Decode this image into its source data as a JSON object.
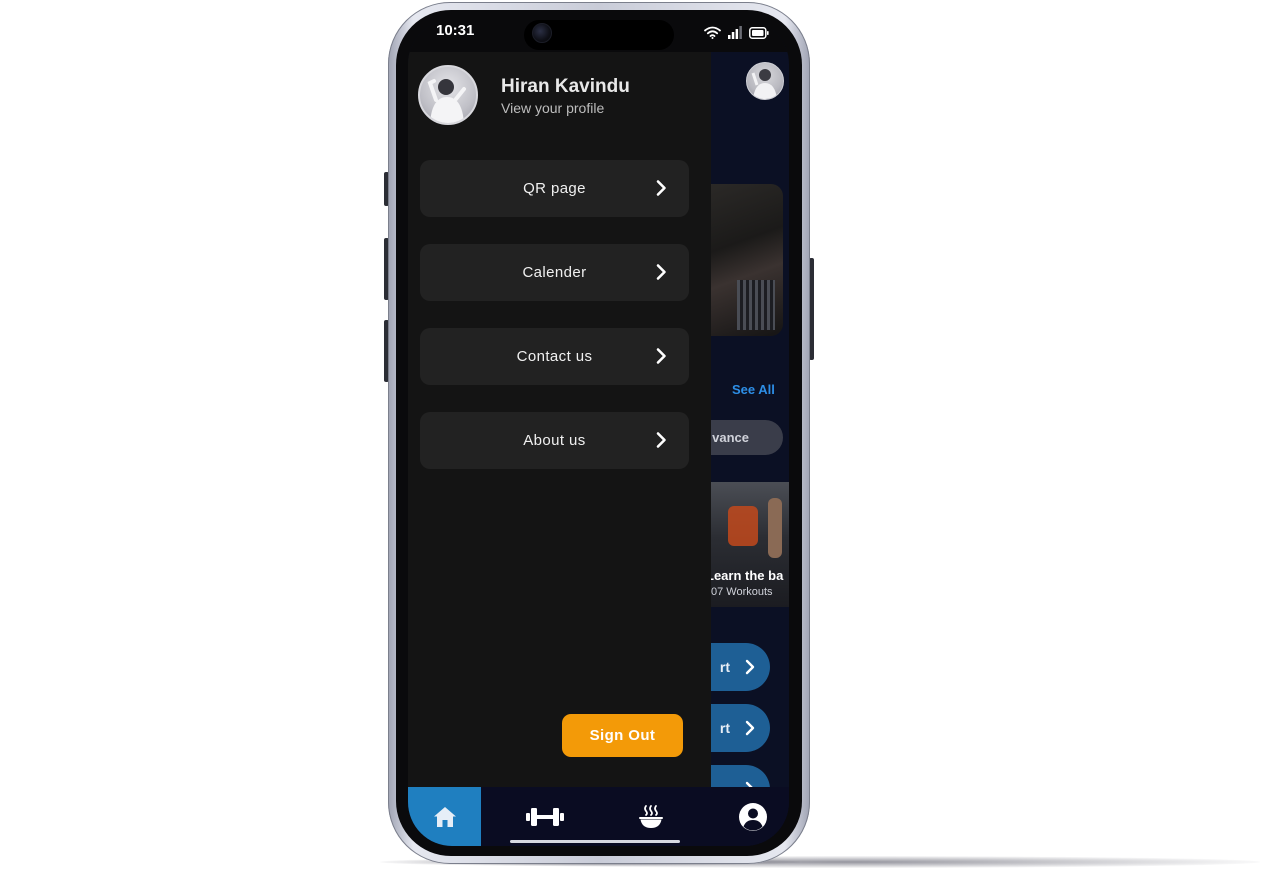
{
  "status_bar": {
    "time": "10:31",
    "icons": [
      "wifi-icon",
      "signal-icon",
      "battery-icon"
    ]
  },
  "drawer": {
    "profile": {
      "name": "Hiran Kavindu",
      "subtitle": "View your profile"
    },
    "menu": [
      {
        "label": "QR page",
        "icon": "chevron-right-icon"
      },
      {
        "label": "Calender",
        "icon": "chevron-right-icon"
      },
      {
        "label": "Contact us",
        "icon": "chevron-right-icon"
      },
      {
        "label": "About us",
        "icon": "chevron-right-icon"
      }
    ],
    "sign_out_label": "Sign Out"
  },
  "background_screen": {
    "see_all_label": "See All",
    "chip_label": "vance",
    "card_title": "Learn the ba",
    "card_subtitle": "07 Workouts",
    "start_buttons": [
      "rt",
      "rt",
      ""
    ]
  },
  "bottom_nav": {
    "items": [
      {
        "icon": "home-icon",
        "active": true
      },
      {
        "icon": "dumbbell-icon",
        "active": false
      },
      {
        "icon": "food-bowl-icon",
        "active": false
      },
      {
        "icon": "user-profile-icon",
        "active": false
      }
    ]
  },
  "colors": {
    "drawer_bg": "#141414",
    "menu_item_bg": "#222222",
    "sign_out": "#f39a08",
    "nav_bg": "#0a0c22",
    "nav_active": "#1f7fc0",
    "link_blue": "#2d8ee6",
    "start_button": "#1e5f95"
  }
}
